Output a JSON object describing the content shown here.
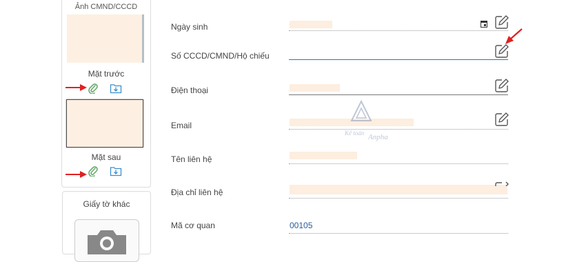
{
  "id_panel": {
    "title": "Ảnh CMND/CCCD",
    "front_label": "Mặt trước",
    "back_label": "Mặt sau"
  },
  "other_panel": {
    "title": "Giấy tờ khác"
  },
  "fields": [
    {
      "label": "Ngày sinh",
      "value": ""
    },
    {
      "label": "Số CCCD/CMND/Hộ chiếu",
      "value": ""
    },
    {
      "label": "Điện thoại",
      "value": ""
    },
    {
      "label": "Email",
      "value": ""
    },
    {
      "label": "Tên liên hệ",
      "value": ""
    },
    {
      "label": "Địa chỉ liên hệ",
      "value": ""
    },
    {
      "label": "Mã cơ quan",
      "value": "00105"
    }
  ],
  "watermark": {
    "text_a": "Kế toán",
    "text_b": "Anpha"
  },
  "colors": {
    "accent_blue": "#1f78c8",
    "arrow_red": "#e02020",
    "attach_green": "#6aaa6e",
    "download_blue": "#3a8fd0",
    "redacted": "#fdeee0"
  },
  "icons": {
    "attach": "paperclip-icon",
    "download": "download-icon",
    "edit": "edit-pencil-icon",
    "calendar": "calendar-icon",
    "camera": "camera-icon"
  }
}
